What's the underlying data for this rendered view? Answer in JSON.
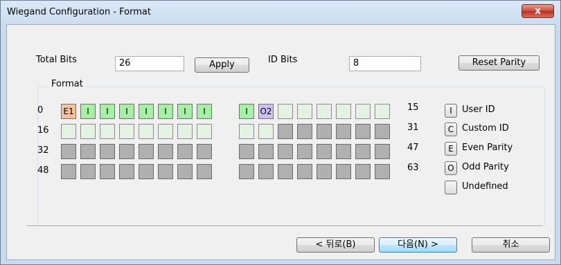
{
  "window": {
    "title": "Wiegand Configuration - Format",
    "close_glyph": "x"
  },
  "fields": {
    "total_bits_label": "Total Bits",
    "total_bits_value": "26",
    "apply_label": "Apply",
    "id_bits_label": "ID Bits",
    "id_bits_value": "8",
    "reset_parity_label": "Reset Parity"
  },
  "format": {
    "title": "Format",
    "row_labels": [
      "0",
      "16",
      "32",
      "48"
    ],
    "row_end_labels": [
      "15",
      "31",
      "47",
      "63"
    ],
    "rows": [
      [
        {
          "code": "E1",
          "type": "even"
        },
        {
          "code": "I",
          "type": "user"
        },
        {
          "code": "I",
          "type": "user"
        },
        {
          "code": "I",
          "type": "user"
        },
        {
          "code": "I",
          "type": "user"
        },
        {
          "code": "I",
          "type": "user"
        },
        {
          "code": "I",
          "type": "user"
        },
        {
          "code": "I",
          "type": "user"
        },
        {
          "code": "I",
          "type": "user"
        },
        {
          "code": "O2",
          "type": "odd"
        },
        {
          "code": "",
          "type": "empty"
        },
        {
          "code": "",
          "type": "empty"
        },
        {
          "code": "",
          "type": "empty"
        },
        {
          "code": "",
          "type": "empty"
        },
        {
          "code": "",
          "type": "empty"
        },
        {
          "code": "",
          "type": "empty"
        }
      ],
      [
        {
          "code": "",
          "type": "empty"
        },
        {
          "code": "",
          "type": "empty"
        },
        {
          "code": "",
          "type": "empty"
        },
        {
          "code": "",
          "type": "empty"
        },
        {
          "code": "",
          "type": "empty"
        },
        {
          "code": "",
          "type": "empty"
        },
        {
          "code": "",
          "type": "empty"
        },
        {
          "code": "",
          "type": "empty"
        },
        {
          "code": "",
          "type": "empty"
        },
        {
          "code": "",
          "type": "empty"
        },
        {
          "code": "",
          "type": "undef"
        },
        {
          "code": "",
          "type": "undef"
        },
        {
          "code": "",
          "type": "undef"
        },
        {
          "code": "",
          "type": "undef"
        },
        {
          "code": "",
          "type": "undef"
        },
        {
          "code": "",
          "type": "undef"
        }
      ],
      [
        {
          "code": "",
          "type": "undef"
        },
        {
          "code": "",
          "type": "undef"
        },
        {
          "code": "",
          "type": "undef"
        },
        {
          "code": "",
          "type": "undef"
        },
        {
          "code": "",
          "type": "undef"
        },
        {
          "code": "",
          "type": "undef"
        },
        {
          "code": "",
          "type": "undef"
        },
        {
          "code": "",
          "type": "undef"
        },
        {
          "code": "",
          "type": "undef"
        },
        {
          "code": "",
          "type": "undef"
        },
        {
          "code": "",
          "type": "undef"
        },
        {
          "code": "",
          "type": "undef"
        },
        {
          "code": "",
          "type": "undef"
        },
        {
          "code": "",
          "type": "undef"
        },
        {
          "code": "",
          "type": "undef"
        },
        {
          "code": "",
          "type": "undef"
        }
      ],
      [
        {
          "code": "",
          "type": "undef"
        },
        {
          "code": "",
          "type": "undef"
        },
        {
          "code": "",
          "type": "undef"
        },
        {
          "code": "",
          "type": "undef"
        },
        {
          "code": "",
          "type": "undef"
        },
        {
          "code": "",
          "type": "undef"
        },
        {
          "code": "",
          "type": "undef"
        },
        {
          "code": "",
          "type": "undef"
        },
        {
          "code": "",
          "type": "undef"
        },
        {
          "code": "",
          "type": "undef"
        },
        {
          "code": "",
          "type": "undef"
        },
        {
          "code": "",
          "type": "undef"
        },
        {
          "code": "",
          "type": "undef"
        },
        {
          "code": "",
          "type": "undef"
        },
        {
          "code": "",
          "type": "undef"
        },
        {
          "code": "",
          "type": "undef"
        }
      ]
    ]
  },
  "legend": [
    {
      "key": "I",
      "label": "User ID"
    },
    {
      "key": "C",
      "label": "Custom ID"
    },
    {
      "key": "E",
      "label": "Even Parity"
    },
    {
      "key": "O",
      "label": "Odd Parity"
    },
    {
      "key": "",
      "label": "Undefined"
    }
  ],
  "buttons": {
    "back": "< 뒤로(B)",
    "next": "다음(N) >",
    "cancel": "취소"
  },
  "colors": {
    "user_id": "#a6f0a6",
    "even_parity": "#f5c29a",
    "odd_parity": "#cfc0f2",
    "empty": "#e3f2e3",
    "undefined": "#b0b0b0"
  }
}
